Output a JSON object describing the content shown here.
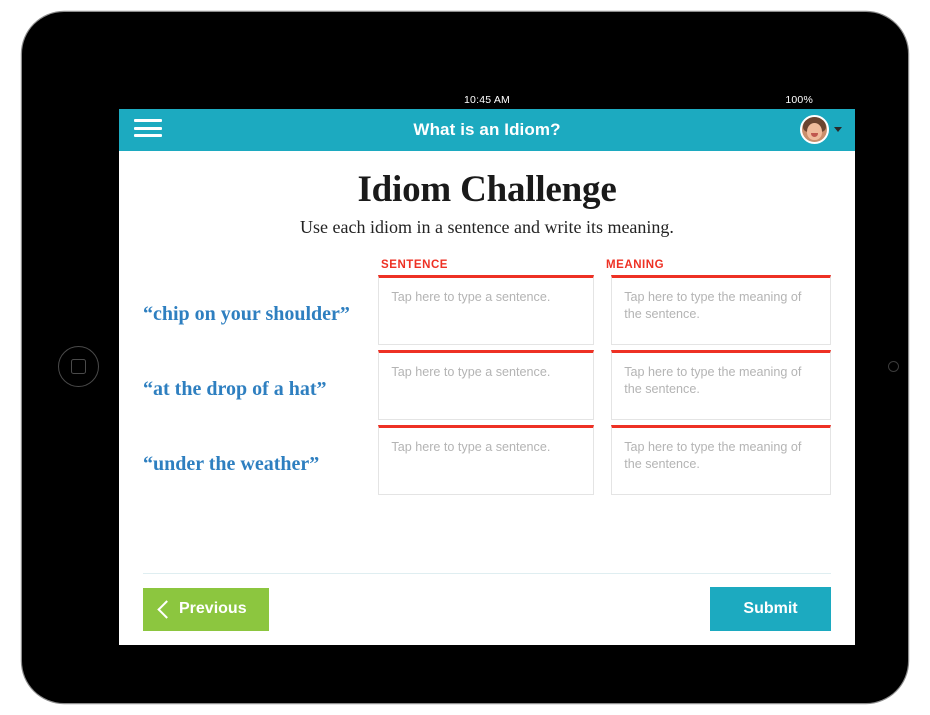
{
  "device": {
    "status_bar": {
      "time": "10:45 AM",
      "battery": "100%"
    },
    "home_button_label": "Home",
    "camera_label": "Front camera"
  },
  "header": {
    "menu_icon": "hamburger-menu-icon",
    "title": "What is an Idiom?",
    "avatar_icon": "user-avatar",
    "caret_icon": "chevron-down-icon",
    "background_color": "#1CAAC0"
  },
  "main": {
    "title": "Idiom Challenge",
    "subtitle": "Use each idiom in a sentence and write its meaning.",
    "columns": {
      "idiom": "",
      "sentence": "SENTENCE",
      "meaning": "MEANING"
    },
    "placeholders": {
      "sentence": "Tap here to type a sentence.",
      "meaning": "Tap here to type the meaning of the sentence."
    },
    "rows": [
      {
        "idiom": "“chip on your shoulder”",
        "sentence_value": "",
        "meaning_value": ""
      },
      {
        "idiom": "“at the drop of a hat”",
        "sentence_value": "",
        "meaning_value": ""
      },
      {
        "idiom": "“under the weather”",
        "sentence_value": "",
        "meaning_value": ""
      }
    ]
  },
  "footer": {
    "previous_label": "Previous",
    "previous_icon": "chevron-left-icon",
    "submit_label": "Submit"
  },
  "colors": {
    "teal": "#1CAAC0",
    "green": "#8CC63F",
    "red": "#EE3124",
    "blue": "#2E7FC0",
    "placeholder_gray": "#b4b4b4"
  }
}
